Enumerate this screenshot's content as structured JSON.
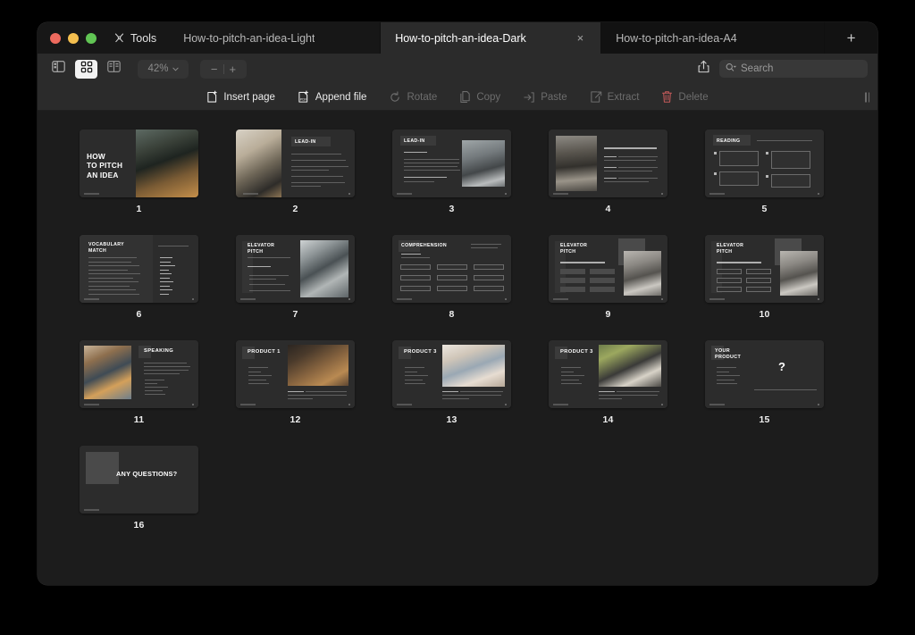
{
  "window": {
    "traffic_lights": [
      "close",
      "minimize",
      "maximize"
    ],
    "tools_label": "Tools"
  },
  "tabs": [
    {
      "label": "How-to-pitch-an-idea-Light",
      "active": false,
      "closable": false
    },
    {
      "label": "How-to-pitch-an-idea-Dark",
      "active": true,
      "closable": true,
      "close_glyph": "×"
    },
    {
      "label": "How-to-pitch-an-idea-A4",
      "active": false,
      "closable": false
    }
  ],
  "new_tab_glyph": "+",
  "toolbar": {
    "sidebar_toggle": "sidebar-icon",
    "grid_view": "grid-view-icon",
    "page_view": "page-view-icon",
    "zoom_value": "42%",
    "zoom_caret": "⌄",
    "zoom_out": "−",
    "zoom_in": "+",
    "share": "share-icon",
    "search_placeholder": "Search",
    "search_value": ""
  },
  "actions": [
    {
      "label": "Insert page",
      "icon": "insert-page-icon",
      "enabled": true,
      "danger": false
    },
    {
      "label": "Append file",
      "icon": "append-file-icon",
      "enabled": true,
      "danger": false
    },
    {
      "label": "Rotate",
      "icon": "rotate-icon",
      "enabled": false,
      "danger": false
    },
    {
      "label": "Copy",
      "icon": "copy-icon",
      "enabled": false,
      "danger": false
    },
    {
      "label": "Paste",
      "icon": "paste-icon",
      "enabled": false,
      "danger": false
    },
    {
      "label": "Extract",
      "icon": "extract-icon",
      "enabled": false,
      "danger": false
    },
    {
      "label": "Delete",
      "icon": "trash-icon",
      "enabled": false,
      "danger": true
    }
  ],
  "colors": {
    "window_bg": "#1c1c1c",
    "toolbar_bg": "#2b2b2b",
    "tab_active_bg": "#2b2b2b",
    "tab_inactive_bg": "#121212",
    "slide_bg": "#2c2c2c",
    "delete_accent": "#c35a5a",
    "traffic_red": "#ed6a5e",
    "traffic_yellow": "#f4bf4f",
    "traffic_green": "#61c554"
  },
  "pages": [
    {
      "number": "1",
      "title": "HOW\nTO PITCH\nAN IDEA",
      "layout": "title-right-photo",
      "photo": "ph-meeting"
    },
    {
      "number": "2",
      "title": "LEAD-IN",
      "layout": "photo-left-bullets",
      "photo": "ph-desk"
    },
    {
      "number": "3",
      "title": "LEAD-IN",
      "layout": "text-left-photo-right",
      "photo": "ph-office",
      "subtitle": "What is a pitch?"
    },
    {
      "number": "4",
      "title": "",
      "layout": "photo-left-paragraphs",
      "photo": "ph-stairs",
      "heading": "There are some common types of pitches."
    },
    {
      "number": "5",
      "title": "READING",
      "layout": "reading-quad",
      "subtitle": "Read the pitch examples and identify what type each one is."
    },
    {
      "number": "6",
      "title": "VOCABULARY\nMATCH",
      "layout": "vocab-match",
      "subtitle": "Match the words and definitions."
    },
    {
      "number": "7",
      "title": "ELEVATOR\nPITCH",
      "layout": "title-left-photo-right",
      "photo": "ph-elevator",
      "subtitle": "Listen to the audio, then answer the questions."
    },
    {
      "number": "8",
      "title": "COMPREHENSION",
      "layout": "comprehension-grid",
      "subtitle": "Listen again, then summarize the audio using the keywords."
    },
    {
      "number": "9",
      "title": "ELEVATOR\nPITCH",
      "layout": "blanks-photo",
      "photo": "ph-street",
      "heading": "Where can elevator pitch be used?"
    },
    {
      "number": "10",
      "title": "ELEVATOR\nPITCH",
      "layout": "filled-photo",
      "photo": "ph-street",
      "heading": "Where can elevator pitch be used?"
    },
    {
      "number": "11",
      "title": "SPEAKING",
      "layout": "photo-left-title-right",
      "photo": "ph-team"
    },
    {
      "number": "12",
      "title": "PRODUCT 1",
      "layout": "product",
      "photo": "ph-box"
    },
    {
      "number": "13",
      "title": "PRODUCT 3",
      "layout": "product",
      "photo": "ph-tablet"
    },
    {
      "number": "14",
      "title": "PRODUCT 3",
      "layout": "product",
      "photo": "ph-chair"
    },
    {
      "number": "15",
      "title": "YOUR\nPRODUCT",
      "layout": "your-product",
      "qmark": "?"
    },
    {
      "number": "16",
      "title": "ANY QUESTIONS?",
      "layout": "any-questions"
    }
  ]
}
